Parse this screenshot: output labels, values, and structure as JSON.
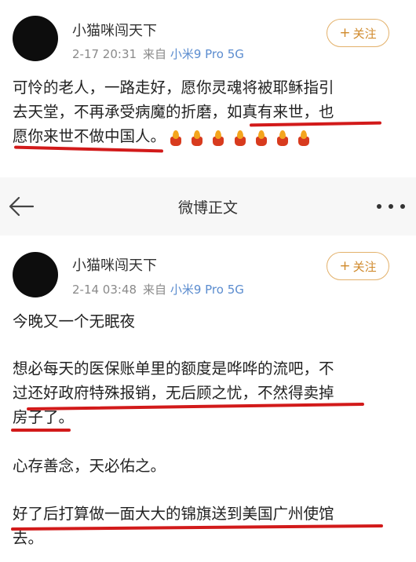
{
  "post1": {
    "username": "小猫咪闯天下",
    "time": "2-17 20:31",
    "source_prefix": "来自",
    "device": "小米9 Pro 5G",
    "follow_label": "关注",
    "lines": [
      "可怜的老人，一路走好，愿你灵魂将被耶稣指引",
      "去天堂，不再承受病魔的折磨，如真有来世，也",
      "愿你来世不做中国人。"
    ]
  },
  "navbar": {
    "title": "微博正文"
  },
  "post2": {
    "username": "小猫咪闯天下",
    "time": "2-14 03:48",
    "source_prefix": "来自",
    "device": "小米9 Pro 5G",
    "follow_label": "关注",
    "para1": "今晚又一个无眠夜",
    "para2_lines": [
      "想必每天的医保账单里的额度是哗哗的流吧，不",
      "过还好政府特殊报销，无后顾之忧，不然得卖掉",
      "房子了。"
    ],
    "para3": "心存善念，天必佑之。",
    "para4_lines": [
      "好了后打算做一面大大的锦旗送到美国广州使馆",
      "去。"
    ]
  },
  "colors": {
    "underline": "#d21a1a",
    "follow_border": "#e3b16b",
    "device_link": "#5b8ccf"
  }
}
